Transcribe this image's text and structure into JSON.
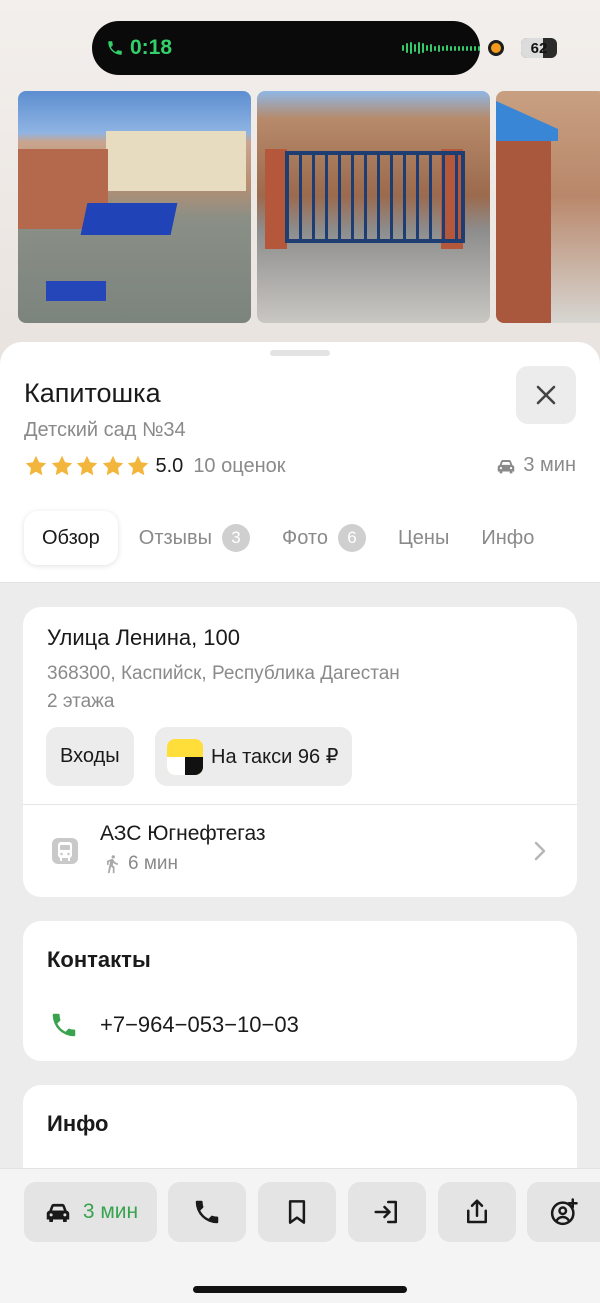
{
  "status_bar": {
    "call_time": "0:18",
    "battery": "62",
    "colors": {
      "call_green": "#33d06a",
      "mic_dot": "#f39a1c"
    }
  },
  "photos": [
    {
      "name": "aerial-courtyard-photo"
    },
    {
      "name": "gate-photo"
    },
    {
      "name": "pillar-photo"
    }
  ],
  "place": {
    "title": "Капитошка",
    "subtitle": "Детский сад №34",
    "rating_value": "5.0",
    "rating_count": "10 оценок",
    "stars": 5,
    "drive_eta": "3 мин"
  },
  "tabs": [
    {
      "label": "Обзор",
      "active": true
    },
    {
      "label": "Отзывы",
      "badge": "3"
    },
    {
      "label": "Фото",
      "badge": "6"
    },
    {
      "label": "Цены"
    },
    {
      "label": "Инфо"
    }
  ],
  "address": {
    "street": "Улица Ленина, 100",
    "line": "368300, Каспийск, Республика Дагестан",
    "floors": "2 этажа",
    "entrances_label": "Входы",
    "taxi_label": "На такси 96 ₽"
  },
  "transit": {
    "stop_name": "АЗС Югнефтегаз",
    "walk_time": "6 мин"
  },
  "contacts": {
    "title": "Контакты",
    "phone": "+7−964−053−10−03"
  },
  "info": {
    "title": "Инфо"
  },
  "bottom_bar": {
    "route_label": "3 мин",
    "accent": "#38a34e"
  }
}
